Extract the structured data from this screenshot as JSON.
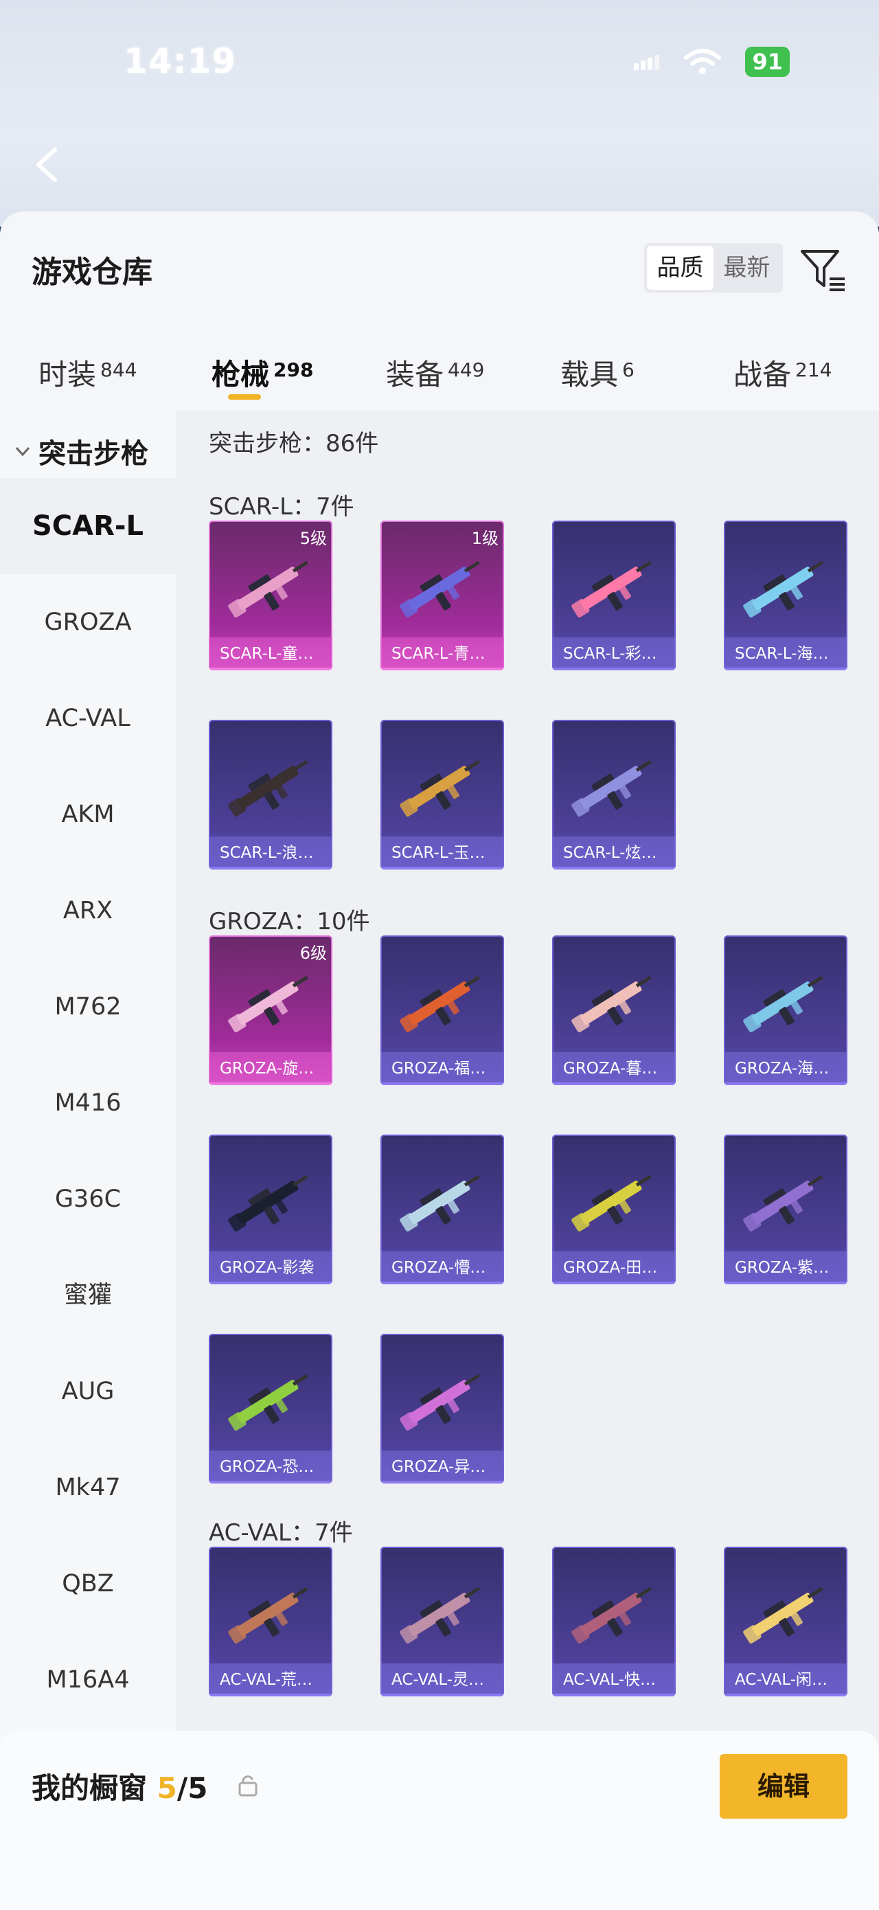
{
  "status_bar": {
    "time": "14:19",
    "battery": "91"
  },
  "sheet": {
    "title": "游戏仓库",
    "sort_options": [
      "品质",
      "最新"
    ],
    "sort_active": "品质"
  },
  "tabs": [
    {
      "label": "时装",
      "count": "844"
    },
    {
      "label": "枪械",
      "count": "298"
    },
    {
      "label": "装备",
      "count": "449"
    },
    {
      "label": "载具",
      "count": "6"
    },
    {
      "label": "战备",
      "count": "214"
    }
  ],
  "sidebar": {
    "category": "突击步枪",
    "items": [
      "SCAR-L",
      "GROZA",
      "AC-VAL",
      "AKM",
      "ARX",
      "M762",
      "M416",
      "G36C",
      "蜜獾",
      "AUG",
      "Mk47",
      "QBZ",
      "M16A4"
    ]
  },
  "content": {
    "count_line": "突击步枪：86件",
    "groups": [
      {
        "title": "SCAR-L：7件",
        "items": [
          {
            "name": "SCAR-L-童…",
            "level": "5级",
            "quality": "pink"
          },
          {
            "name": "SCAR-L-青…",
            "level": "1级",
            "quality": "pink"
          },
          {
            "name": "SCAR-L-彩…",
            "level": "",
            "quality": "purple"
          },
          {
            "name": "SCAR-L-海…",
            "level": "",
            "quality": "purple"
          },
          {
            "name": "SCAR-L-浪…",
            "level": "",
            "quality": "purple"
          },
          {
            "name": "SCAR-L-玉…",
            "level": "",
            "quality": "purple"
          },
          {
            "name": "SCAR-L-炫…",
            "level": "",
            "quality": "purple"
          }
        ]
      },
      {
        "title": "GROZA：10件",
        "items": [
          {
            "name": "GROZA-旋…",
            "level": "6级",
            "quality": "pink"
          },
          {
            "name": "GROZA-福…",
            "level": "",
            "quality": "purple"
          },
          {
            "name": "GROZA-暮…",
            "level": "",
            "quality": "purple"
          },
          {
            "name": "GROZA-海…",
            "level": "",
            "quality": "purple"
          },
          {
            "name": "GROZA-影袭",
            "level": "",
            "quality": "purple"
          },
          {
            "name": "GROZA-懵…",
            "level": "",
            "quality": "purple"
          },
          {
            "name": "GROZA-田…",
            "level": "",
            "quality": "purple"
          },
          {
            "name": "GROZA-紫…",
            "level": "",
            "quality": "purple"
          },
          {
            "name": "GROZA-恐…",
            "level": "",
            "quality": "purple"
          },
          {
            "name": "GROZA-异…",
            "level": "",
            "quality": "purple"
          }
        ]
      },
      {
        "title": "AC-VAL：7件",
        "items": [
          {
            "name": "AC-VAL-荒…",
            "level": "",
            "quality": "purple"
          },
          {
            "name": "AC-VAL-灵…",
            "level": "",
            "quality": "purple"
          },
          {
            "name": "AC-VAL-快…",
            "level": "",
            "quality": "purple"
          },
          {
            "name": "AC-VAL-闲…",
            "level": "",
            "quality": "purple"
          }
        ]
      }
    ]
  },
  "bottom_bar": {
    "label": "我的橱窗",
    "used": "5",
    "total": "/5",
    "edit_label": "编辑"
  },
  "gun_colors": [
    "#e9a0c8",
    "#6a6ae0",
    "#ff7aa8",
    "#7fd0f0",
    "#3a3030",
    "#d8a040",
    "#9090e0",
    "#f0b8d8",
    "#e06030",
    "#f0c0b8",
    "#7ec8e8",
    "#1a2030",
    "#b8d8e8",
    "#d8d040",
    "#9070d0",
    "#90d040",
    "#d070d8",
    "#c07858",
    "#c090a8",
    "#b0607a",
    "#f0d070"
  ]
}
